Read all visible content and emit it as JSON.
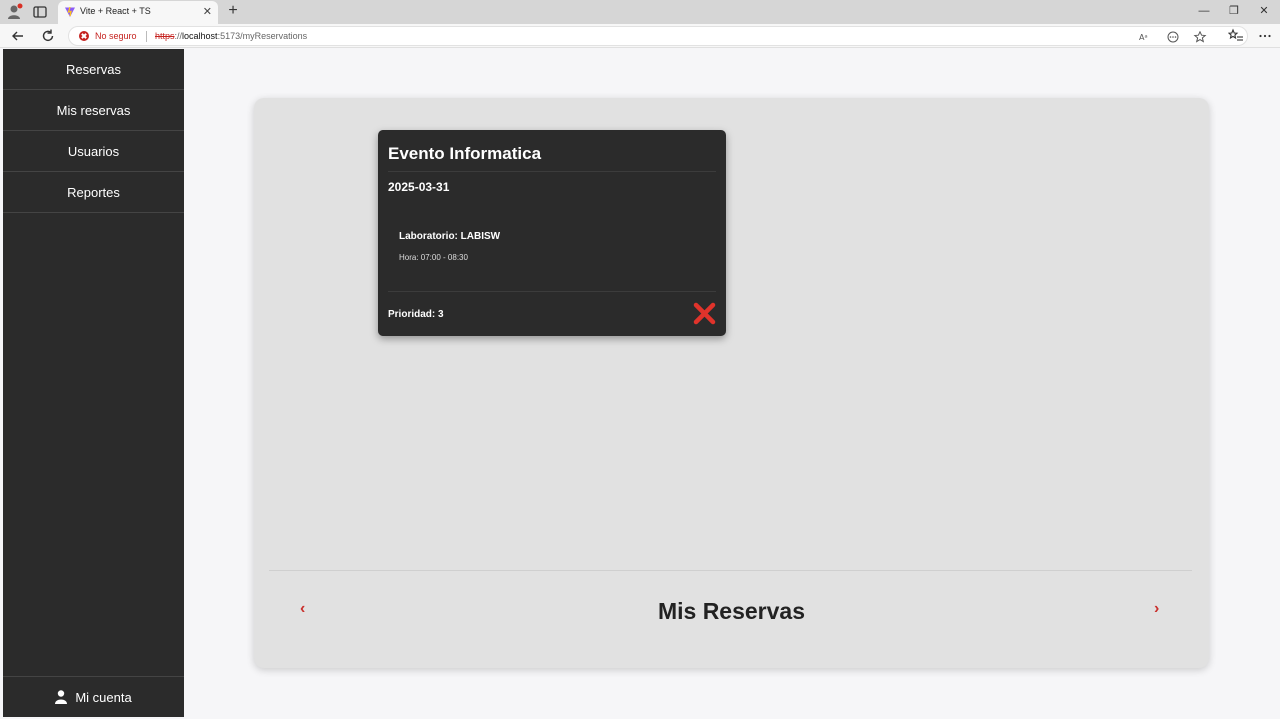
{
  "browser": {
    "tab_title": "Vite + React + TS",
    "tab_close": "✕",
    "new_tab": "+",
    "security_text": "No seguro",
    "url_scheme": "https",
    "url_rest": "://",
    "url_host": "localhost",
    "url_path": ":5173/myReservations",
    "window_controls": {
      "minimize": "—",
      "restore": "❐",
      "close": "✕"
    },
    "toolbar_icons": [
      "read-aloud-icon",
      "extension-icon",
      "favorite-star-icon",
      "favorites-list-icon",
      "more-menu-icon"
    ]
  },
  "sidebar": {
    "items": [
      {
        "label": "Reservas"
      },
      {
        "label": "Mis reservas"
      },
      {
        "label": "Usuarios"
      },
      {
        "label": "Reportes"
      }
    ],
    "account_label": "Mi cuenta"
  },
  "main": {
    "title": "Mis Reservas",
    "prev_label": "‹",
    "next_label": "›",
    "reservations": [
      {
        "event": "Evento Informatica",
        "date": "2025-03-31",
        "lab": "Laboratorio: LABISW",
        "time": "Hora: 07:00 - 08:30",
        "priority": "Prioridad: 3"
      }
    ]
  },
  "colors": {
    "sidebar_bg": "#2b2b2b",
    "card_bg": "#2b2b2b",
    "panel_bg": "#e1e1e1",
    "accent_red": "#e0332b"
  }
}
